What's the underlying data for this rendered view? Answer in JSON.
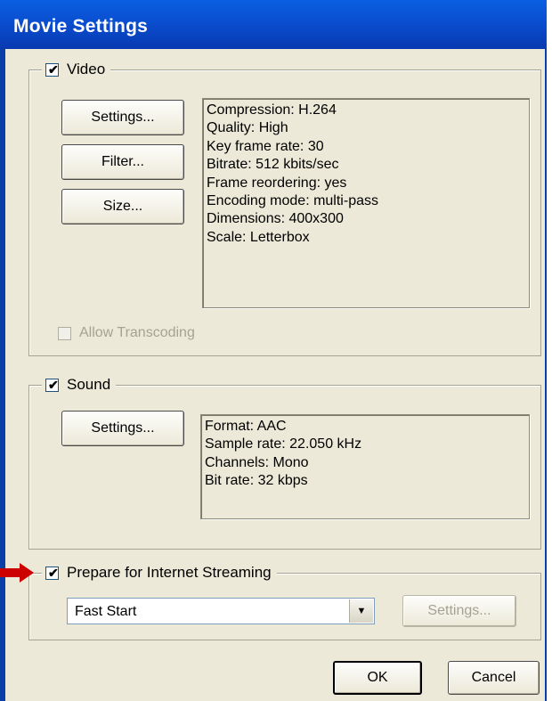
{
  "window": {
    "title": "Movie Settings"
  },
  "video": {
    "label": "Video",
    "checked": true,
    "buttons": {
      "settings": "Settings...",
      "filter": "Filter...",
      "size": "Size..."
    },
    "info": [
      "Compression: H.264",
      "Quality: High",
      "Key frame rate: 30",
      "Bitrate: 512 kbits/sec",
      "Frame reordering: yes",
      "Encoding mode: multi-pass",
      "Dimensions: 400x300",
      "Scale: Letterbox"
    ],
    "allow_transcoding": {
      "label": "Allow Transcoding",
      "checked": false,
      "enabled": false
    }
  },
  "sound": {
    "label": "Sound",
    "checked": true,
    "buttons": {
      "settings": "Settings..."
    },
    "info": [
      "Format: AAC",
      "Sample rate: 22.050 kHz",
      "Channels: Mono",
      "Bit rate: 32 kbps"
    ]
  },
  "streaming": {
    "label": "Prepare for Internet Streaming",
    "checked": true,
    "selected_option": "Fast Start",
    "settings_button": "Settings...",
    "settings_enabled": false
  },
  "footer": {
    "ok": "OK",
    "cancel": "Cancel"
  },
  "annotation": {
    "arrow_color": "#cc0000"
  }
}
